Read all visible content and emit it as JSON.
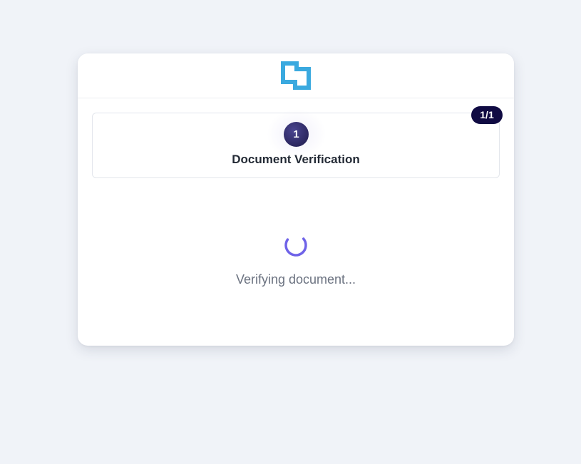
{
  "header": {
    "logo": "brand-logo-icon"
  },
  "step": {
    "number": "1",
    "title": "Document Verification",
    "progress_badge": "1/1"
  },
  "status": {
    "icon": "loading-spinner-icon",
    "message": "Verifying document..."
  },
  "colors": {
    "background": "#f0f3f8",
    "logo": "#3aa9df",
    "step_circle": "#2b275f",
    "badge": "#100b43",
    "spinner": "#6f63e8"
  }
}
